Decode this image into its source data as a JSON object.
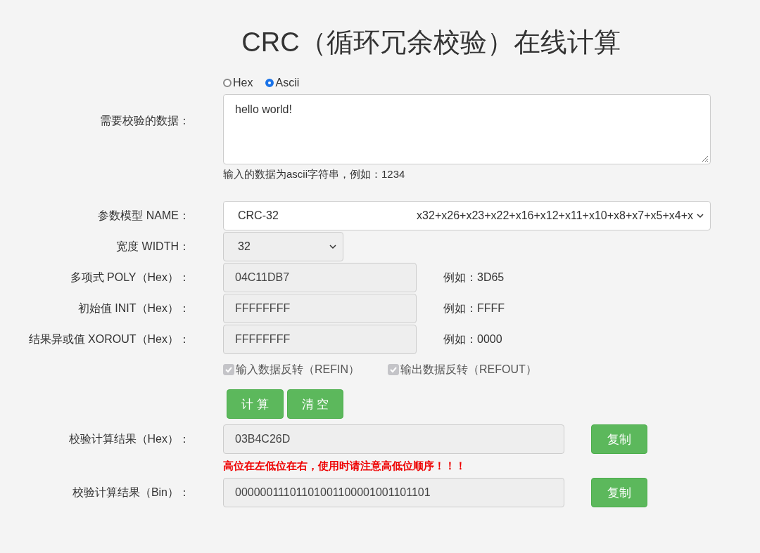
{
  "title": "CRC（循环冗余校验）在线计算",
  "input_mode": [
    {
      "label": "Hex",
      "selected": false
    },
    {
      "label": "Ascii",
      "selected": true
    }
  ],
  "data_field": {
    "label": "需要校验的数据：",
    "value": "hello world!",
    "hint": "输入的数据为ascii字符串，例如：1234"
  },
  "model_select": {
    "label": "参数模型 NAME：",
    "value": "CRC-32",
    "polynomial": "x32+x26+x23+x22+x16+x12+x11+x10+x8+x7+x5+x4+x"
  },
  "width_select": {
    "label": "宽度 WIDTH：",
    "value": "32"
  },
  "params": [
    {
      "label": "多项式 POLY（Hex）：",
      "value": "04C11DB7",
      "example": "例如：3D65"
    },
    {
      "label": "初始值 INIT（Hex）：",
      "value": "FFFFFFFF",
      "example": "例如：FFFF"
    },
    {
      "label": "结果异或值 XOROUT（Hex）：",
      "value": "FFFFFFFF",
      "example": "例如：0000"
    }
  ],
  "reflect_options": [
    {
      "label": "输入数据反转（REFIN）",
      "checked": true,
      "disabled": true
    },
    {
      "label": "输出数据反转（REFOUT）",
      "checked": true,
      "disabled": true
    }
  ],
  "buttons": [
    "计 算",
    "清 空"
  ],
  "result_hex": {
    "label": "校验计算结果（Hex）：",
    "value": "03B4C26D",
    "copy": "复制"
  },
  "warning": "高位在左低位在右，使用时请注意高低位顺序！！！",
  "result_bin": {
    "label": "校验计算结果（Bin）：",
    "value": "00000011101101001100001001101101",
    "copy": "复制"
  }
}
